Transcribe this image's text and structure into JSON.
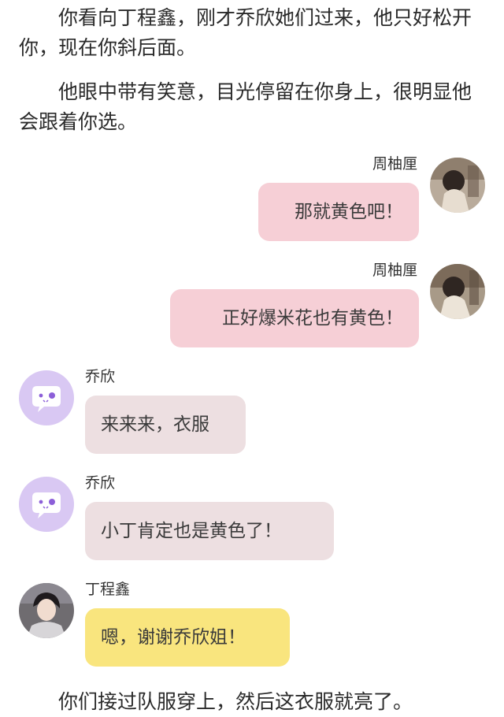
{
  "story": {
    "para1": "你看向丁程鑫，刚才乔欣她们过来，他只好松开你，现在你斜后面。",
    "para2": "他眼中带有笑意，目光停留在你身上，很明显他会跟着你选。",
    "para3": "你们接过队服穿上，然后这衣服就亮了。"
  },
  "messages": [
    {
      "sender": "周柚厘",
      "text": "那就黄色吧！",
      "side": "right",
      "avatar": "photo-avatar-icon"
    },
    {
      "sender": "周柚厘",
      "text": "正好爆米花也有黄色！",
      "side": "right",
      "avatar": "photo-avatar-icon"
    },
    {
      "sender": "乔欣",
      "text": "来来来，衣服",
      "side": "left",
      "avatar": "chat-bubble-avatar-icon"
    },
    {
      "sender": "乔欣",
      "text": "小丁肯定也是黄色了！",
      "side": "left",
      "avatar": "chat-bubble-avatar-icon"
    },
    {
      "sender": "丁程鑫",
      "text": "嗯，谢谢乔欣姐！",
      "side": "left",
      "avatar": "person-photo-avatar-icon"
    }
  ],
  "colors": {
    "right_bubble": "#f6cfd6",
    "left_bubble": "#eddfe1",
    "highlight_bubble": "#f9e57e",
    "default_avatar_bg": "#d9c8f3",
    "default_avatar_accent": "#8c5fd8"
  }
}
